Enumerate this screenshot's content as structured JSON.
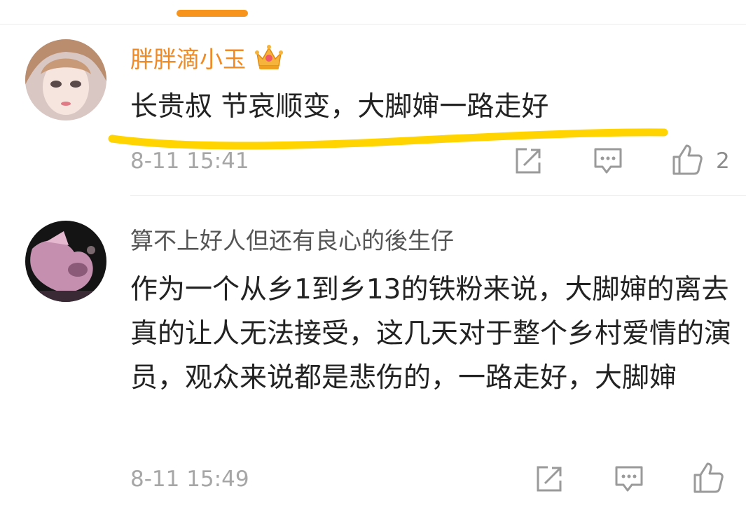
{
  "comments": [
    {
      "username": "胖胖滴小玉",
      "badge": "crown-icon",
      "text": "长贵叔 节哀顺变，大脚婶一路走好",
      "timestamp": "8-11 15:41",
      "like_count": "2"
    },
    {
      "username": "算不上好人但还有良心的後生仔",
      "text": "作为一个从乡1到乡13的铁粉来说，大脚婶的离去真的让人无法接受，这几天对于整个乡村爱情的演员，观众来说都是悲伤的，一路走好，大脚婶",
      "timestamp": "8-11 15:49",
      "like_count": ""
    }
  ],
  "colors": {
    "accent": "#f7941d",
    "vip_name": "#f08a24",
    "highlight": "#ffd400",
    "icon": "#9a9a9a"
  }
}
